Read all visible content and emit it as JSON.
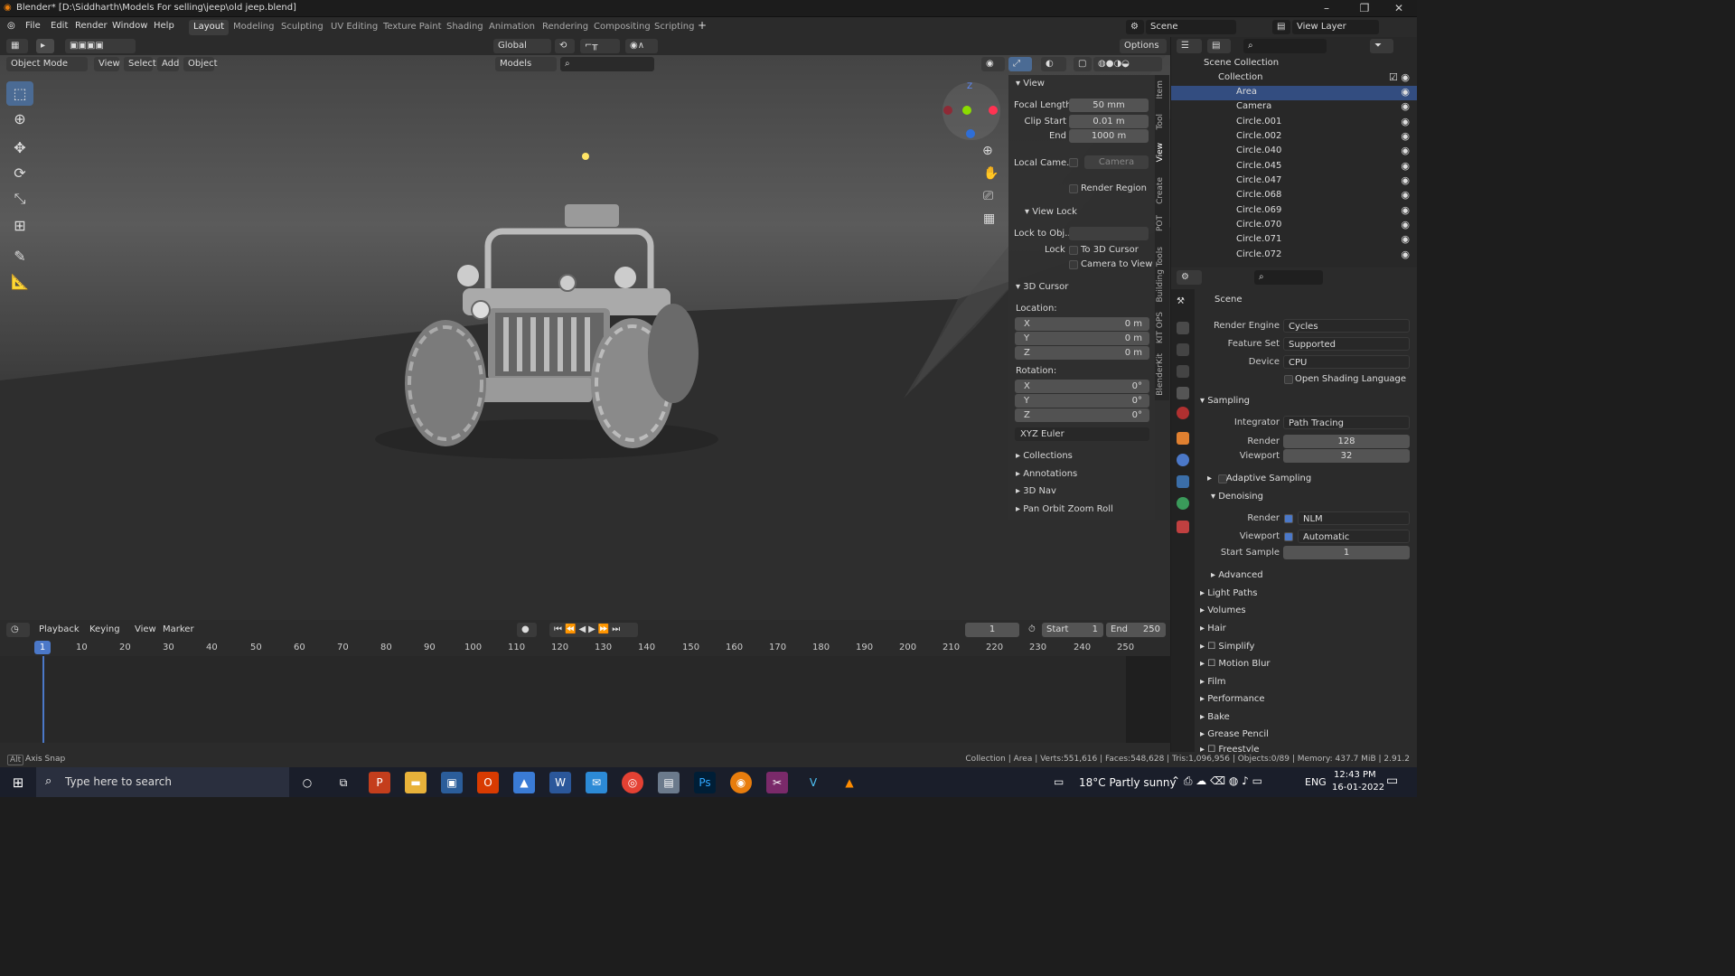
{
  "window": {
    "title": "Blender* [D:\\Siddharth\\Models For selling\\jeep\\old jeep.blend]"
  },
  "menu": [
    "File",
    "Edit",
    "Render",
    "Window",
    "Help"
  ],
  "workspaces": [
    "Layout",
    "Modeling",
    "Sculpting",
    "UV Editing",
    "Texture Paint",
    "Shading",
    "Animation",
    "Rendering",
    "Compositing",
    "Scripting"
  ],
  "topright": {
    "scene": "Scene",
    "view_layer": "View Layer"
  },
  "viewport_header": {
    "orientation": "Global",
    "options": "Options",
    "mode": "Object Mode",
    "view": "View",
    "select": "Select",
    "add": "Add",
    "object": "Object",
    "collection_filter": "Models"
  },
  "npanel": {
    "view_title": "View",
    "focal_length_label": "Focal Length",
    "focal_length": "50 mm",
    "clip_start_label": "Clip Start",
    "clip_start": "0.01 m",
    "end_label": "End",
    "end": "1000 m",
    "local_camera_label": "Local Came...",
    "local_camera": "Camera",
    "render_region": "Render Region",
    "view_lock_title": "View Lock",
    "lock_to_obj_label": "Lock to Obj...",
    "lock_label": "Lock",
    "to_3d_cursor": "To 3D Cursor",
    "camera_to_view": "Camera to View",
    "cursor_title": "3D Cursor",
    "location_label": "Location:",
    "loc": [
      {
        "axis": "X",
        "value": "0 m"
      },
      {
        "axis": "Y",
        "value": "0 m"
      },
      {
        "axis": "Z",
        "value": "0 m"
      }
    ],
    "rotation_label": "Rotation:",
    "rot": [
      {
        "axis": "X",
        "value": "0°"
      },
      {
        "axis": "Y",
        "value": "0°"
      },
      {
        "axis": "Z",
        "value": "0°"
      }
    ],
    "rotation_mode": "XYZ Euler",
    "collapsed": [
      "Collections",
      "Annotations",
      "3D Nav",
      "Pan Orbit Zoom Roll"
    ]
  },
  "ntabs": [
    "Item",
    "Tool",
    "View",
    "Create",
    "POT",
    "Building Tools",
    "KIT OPS",
    "BlenderKit"
  ],
  "outliner": {
    "scene_collection": "Scene Collection",
    "collection": "Collection",
    "items": [
      "Area",
      "Camera",
      "Circle.001",
      "Circle.002",
      "Circle.040",
      "Circle.045",
      "Circle.047",
      "Circle.068",
      "Circle.069",
      "Circle.070",
      "Circle.071",
      "Circle.072"
    ]
  },
  "properties": {
    "scene": "Scene",
    "render_engine_label": "Render Engine",
    "render_engine": "Cycles",
    "feature_set_label": "Feature Set",
    "feature_set": "Supported",
    "device_label": "Device",
    "device": "CPU",
    "osl": "Open Shading Language",
    "sampling": "Sampling",
    "integrator_label": "Integrator",
    "integrator": "Path Tracing",
    "render_label": "Render",
    "render_samples": "128",
    "viewport_label": "Viewport",
    "viewport_samples": "32",
    "adaptive_sampling": "Adaptive Sampling",
    "denoising": "Denoising",
    "den_render_label": "Render",
    "den_render": "NLM",
    "den_viewport_label": "Viewport",
    "den_viewport": "Automatic",
    "start_sample_label": "Start Sample",
    "start_sample": "1",
    "advanced": "Advanced",
    "sections": [
      "Light Paths",
      "Volumes",
      "Hair",
      "Simplify",
      "Motion Blur",
      "Film",
      "Performance",
      "Bake",
      "Grease Pencil",
      "Freestyle"
    ]
  },
  "timeline": {
    "playback": "Playback",
    "keying": "Keying",
    "view": "View",
    "marker": "Marker",
    "current_frame": "1",
    "start_label": "Start",
    "start": "1",
    "end_label": "End",
    "end": "250",
    "ruler": [
      "10",
      "20",
      "30",
      "40",
      "50",
      "60",
      "70",
      "80",
      "90",
      "100",
      "110",
      "120",
      "130",
      "140",
      "150",
      "160",
      "170",
      "180",
      "190",
      "200",
      "210",
      "220",
      "230",
      "240",
      "250"
    ],
    "playhead": "1"
  },
  "status": {
    "left": "Axis Snap",
    "right": "Collection | Area | Verts:551,616 | Faces:548,628 | Tris:1,096,956 | Objects:0/89 | Memory: 437.7 MiB | 2.91.2"
  },
  "taskbar": {
    "search": "Type here to search",
    "weather": "18°C  Partly sunny",
    "lang": "ENG",
    "time": "12:43 PM",
    "date": "16-01-2022"
  }
}
